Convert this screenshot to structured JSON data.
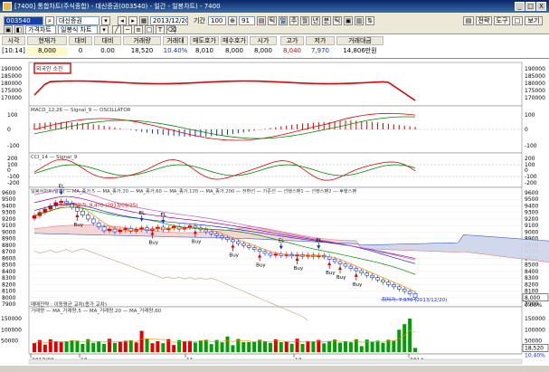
{
  "titlebar": {
    "text": "[7400] 통합차트(주식종합) - 대신증권(003540) - 일간 - 일봉차트) - 7400",
    "minimize": "_",
    "maximize": "□",
    "close": "X"
  },
  "toolbar": {
    "code": "003540",
    "name": "대신증권",
    "date": "2013/12/20",
    "period_label": "기간",
    "period_value": "100",
    "zoom_value": "91",
    "chart_type": "가격차트",
    "chart_style": "일봉식 차트",
    "interval_buttons": [
      "주",
      "월",
      "년",
      "분",
      "틱"
    ],
    "right_buttons": [
      "▤",
      "전략",
      "도구",
      "□",
      "보기"
    ],
    "selected_interval": "일"
  },
  "quote": {
    "headers": [
      "시각",
      "현재가",
      "대비",
      "대비",
      "거래량",
      "거래대",
      "매도호가",
      "매수호가",
      "시가",
      "고가",
      "저가",
      "거래대금"
    ],
    "values": [
      "[10:14]",
      "8,000",
      "0",
      "0.00",
      "18,520",
      "10.40%",
      "8,010",
      "8,000",
      "8,000",
      "8,040",
      "7,970",
      "14,806만원"
    ]
  },
  "panels": {
    "investor_label": "외국인 소진",
    "investor_ticks": [
      "190000",
      "185000",
      "180000",
      "175000",
      "170000"
    ],
    "macd_label": "MACD_12,26 — Signal_9 — OSCILLATOR",
    "macd_ticks": [
      "100",
      "0",
      "-100"
    ],
    "cci_label": "CCI_14 — Signal_9",
    "cci_ticks": [
      "200",
      "100",
      "0",
      "-100",
      "-200"
    ],
    "price_label": "일봉식차트(일간) — MA_종가,5 — MA_종가,20 — MA_종가,60 — MA_종가,120 — MA_종가,200 — 전환선 — 기준선 — 선행스팬1 — 선행스팬2 — 후행스팬",
    "price_ticks": [
      "9600",
      "9500",
      "9400",
      "9300",
      "9200",
      "9100",
      "9000",
      "8900",
      "8800",
      "8700",
      "8600",
      "8500",
      "8400",
      "8300",
      "8200",
      "8100",
      "8000",
      "7900"
    ],
    "high_note": "최고가: 9,470 (2013/09/25)",
    "low_note": "최저가: 7,970 (2013/12/20)",
    "price_right_tag": "8,000",
    "price_right_pct": "0.00%",
    "volume_strategy_label": "매매전략 : 이동평균 교차(종가 교차)",
    "volume_label": "거래량 — MA_거래량,5 — MA_거래량,20 — MA_거래량,60",
    "volume_ticks": [
      "150000",
      "100000",
      "50000"
    ],
    "volume_right_tag": "18,520",
    "volume_right_pct": "10.40%",
    "buy_tag": "Buy",
    "sell_tag": "EL",
    "x_ticks": [
      "2013/09",
      "10",
      "11",
      "12",
      "2014"
    ]
  },
  "colors": {
    "up": "#e00000",
    "down": "#1030d0",
    "investor_line": "#e00000",
    "cloud": "#f2c8c8",
    "cloud_blue": "#c8d8f0",
    "accent_red_tag": "#e00000"
  }
}
